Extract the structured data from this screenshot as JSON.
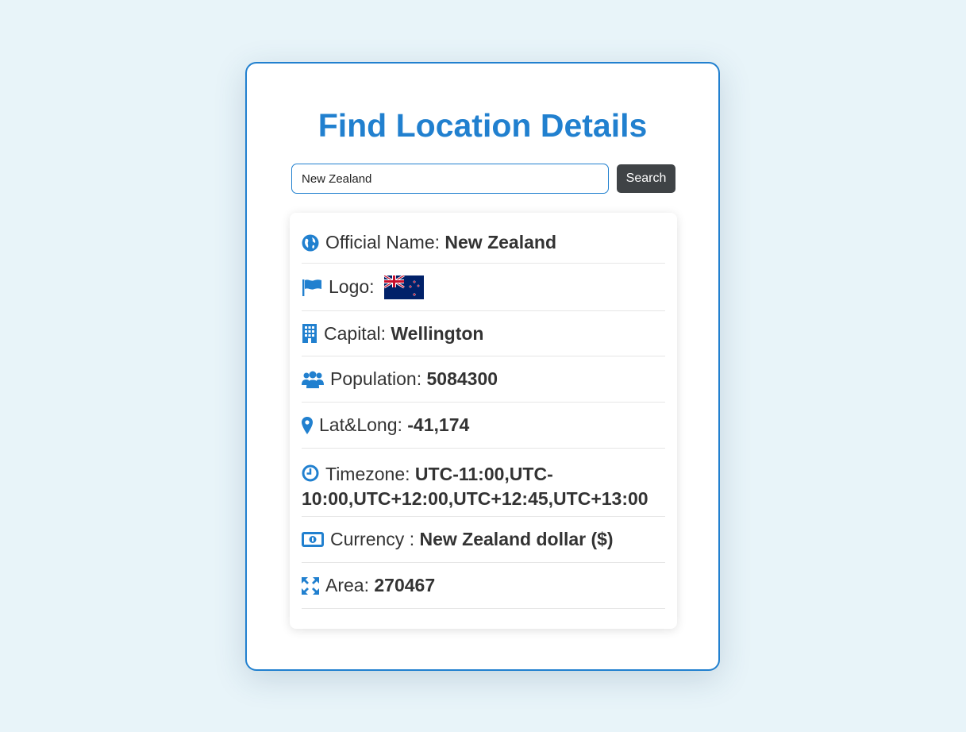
{
  "title": "Find Location Details",
  "search": {
    "value": "New Zealand",
    "button_label": "Search"
  },
  "colors": {
    "accent": "#2180cf",
    "background": "#e8f4f9",
    "button": "#3f4346"
  },
  "details": [
    {
      "icon": "globe-icon",
      "label": "Official Name: ",
      "value": "New Zealand"
    },
    {
      "icon": "flag-icon",
      "label": "Logo: ",
      "value": ""
    },
    {
      "icon": "building-icon",
      "label": "Capital: ",
      "value": "Wellington"
    },
    {
      "icon": "users-icon",
      "label": "Population: ",
      "value": "5084300"
    },
    {
      "icon": "map-pin-icon",
      "label": "Lat&Long: ",
      "value": "-41,174"
    },
    {
      "icon": "clock-icon",
      "label": "Timezone: ",
      "value": "UTC-11:00,UTC-10:00,UTC+12:00,UTC+12:45,UTC+13:00"
    },
    {
      "icon": "money-icon",
      "label": "Currency : ",
      "value": "New Zealand dollar ($)"
    },
    {
      "icon": "expand-icon",
      "label": "Area: ",
      "value": "270467"
    }
  ]
}
